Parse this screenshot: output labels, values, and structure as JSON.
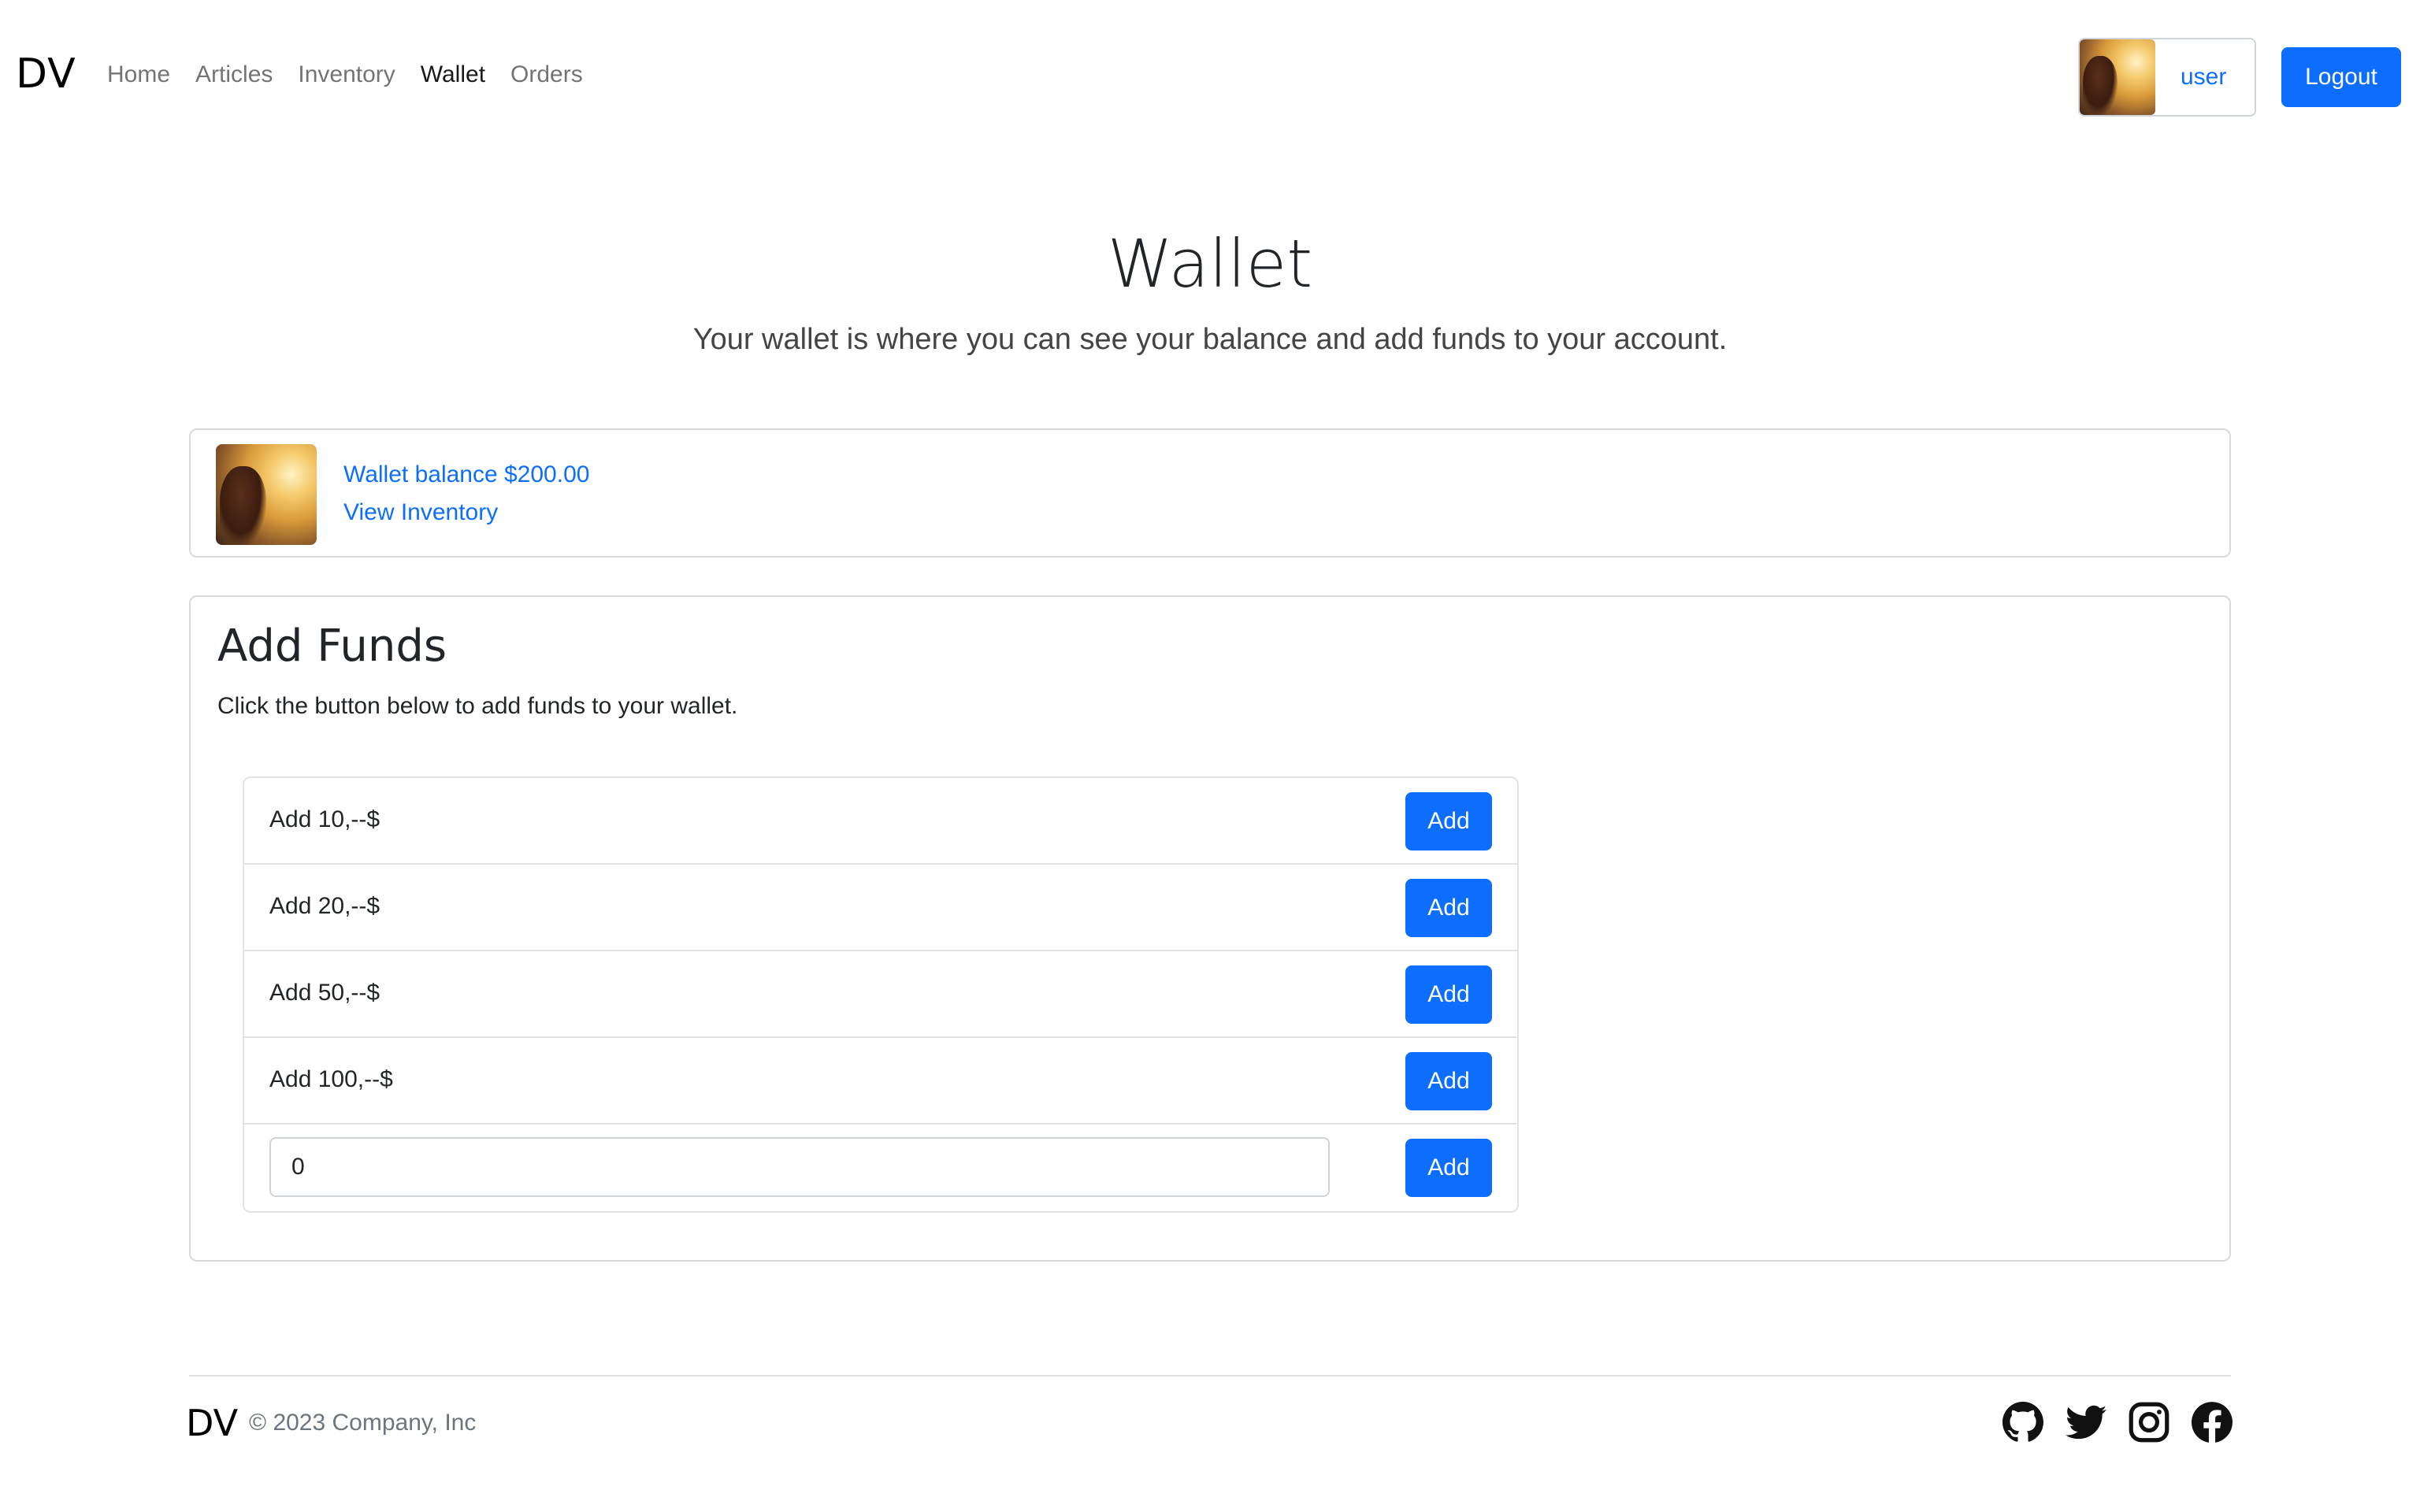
{
  "navbar": {
    "brand": "DV",
    "links": [
      "Home",
      "Articles",
      "Inventory",
      "Wallet",
      "Orders"
    ],
    "active_link": "Wallet",
    "user_label": "user",
    "logout_label": "Logout"
  },
  "header": {
    "title": "Wallet",
    "subtitle": "Your wallet is where you can see your balance and add funds to your account."
  },
  "balance_card": {
    "balance_text": "Wallet balance $200.00",
    "inventory_link": "View Inventory"
  },
  "add_funds": {
    "title": "Add Funds",
    "description": "Click the button below to add funds to your wallet.",
    "options": [
      {
        "label": "Add 10,--$",
        "button": "Add"
      },
      {
        "label": "Add 20,--$",
        "button": "Add"
      },
      {
        "label": "Add 50,--$",
        "button": "Add"
      },
      {
        "label": "Add 100,--$",
        "button": "Add"
      }
    ],
    "custom_amount_value": "0",
    "custom_button": "Add"
  },
  "footer": {
    "brand": "DV",
    "copyright": "© 2023 Company, Inc",
    "social_icons": [
      "github-icon",
      "twitter-icon",
      "instagram-icon",
      "facebook-icon"
    ]
  },
  "colors": {
    "primary": "#0d6efd",
    "text": "#212529",
    "muted": "#6c757d",
    "border": "#d7dadd"
  }
}
